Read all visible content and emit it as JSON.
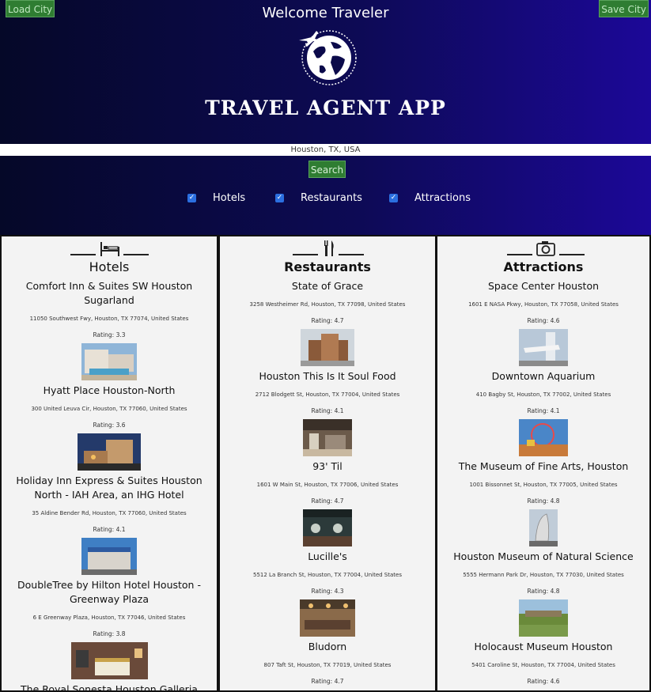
{
  "header": {
    "load_label": "Load City",
    "save_label": "Save City",
    "welcome": "Welcome Traveler",
    "title": "TRAVEL AGENT APP"
  },
  "search": {
    "value": "Houston, TX, USA",
    "button_label": "Search"
  },
  "filters": [
    {
      "label": "Hotels",
      "checked": true
    },
    {
      "label": "Restaurants",
      "checked": true
    },
    {
      "label": "Attractions",
      "checked": true
    }
  ],
  "colors": {
    "button_green": "#2f7d32",
    "header_start": "#050828",
    "header_end": "#1c0898",
    "checkbox": "#2b6fe0"
  },
  "columns": [
    {
      "title": "Hotels",
      "icon": "bed-icon",
      "items": [
        {
          "name": "Comfort Inn & Suites SW Houston Sugarland",
          "address": "11050 Southwest Fwy, Houston, TX 77074, United States",
          "rating": "Rating: 3.3"
        },
        {
          "name": "Hyatt Place Houston-North",
          "address": "300 United Leuva Cir, Houston, TX 77060, United States",
          "rating": "Rating: 3.6"
        },
        {
          "name": "Holiday Inn Express & Suites Houston North - IAH Area, an IHG Hotel",
          "address": "35 Aldine Bender Rd, Houston, TX 77060, United States",
          "rating": "Rating: 4.1"
        },
        {
          "name": "DoubleTree by Hilton Hotel Houston - Greenway Plaza",
          "address": "6 E Greenway Plaza, Houston, TX 77046, United States",
          "rating": "Rating: 3.8"
        },
        {
          "name": "The Royal Sonesta Houston Galleria",
          "address": "",
          "rating": ""
        }
      ]
    },
    {
      "title": "Restaurants",
      "icon": "fork-knife-icon",
      "items": [
        {
          "name": "State of Grace",
          "address": "3258 Westheimer Rd, Houston, TX 77098, United States",
          "rating": "Rating: 4.7"
        },
        {
          "name": "Houston This Is It Soul Food",
          "address": "2712 Blodgett St, Houston, TX 77004, United States",
          "rating": "Rating: 4.1"
        },
        {
          "name": "93' Til",
          "address": "1601 W Main St, Houston, TX 77006, United States",
          "rating": "Rating: 4.7"
        },
        {
          "name": "Lucille's",
          "address": "5512 La Branch St, Houston, TX 77004, United States",
          "rating": "Rating: 4.3"
        },
        {
          "name": "Bludorn",
          "address": "807 Taft St, Houston, TX 77019, United States",
          "rating": "Rating: 4.7"
        }
      ]
    },
    {
      "title": "Attractions",
      "icon": "camera-icon",
      "items": [
        {
          "name": "Space Center Houston",
          "address": "1601 E NASA Pkwy, Houston, TX 77058, United States",
          "rating": "Rating: 4.6"
        },
        {
          "name": "Downtown Aquarium",
          "address": "410 Bagby St, Houston, TX 77002, United States",
          "rating": "Rating: 4.1"
        },
        {
          "name": "The Museum of Fine Arts, Houston",
          "address": "1001 Bissonnet St, Houston, TX 77005, United States",
          "rating": "Rating: 4.8"
        },
        {
          "name": "Houston Museum of Natural Science",
          "address": "5555 Hermann Park Dr, Houston, TX 77030, United States",
          "rating": "Rating: 4.8"
        },
        {
          "name": "Holocaust Museum Houston",
          "address": "5401 Caroline St, Houston, TX 77004, United States",
          "rating": "Rating: 4.6"
        }
      ]
    }
  ]
}
